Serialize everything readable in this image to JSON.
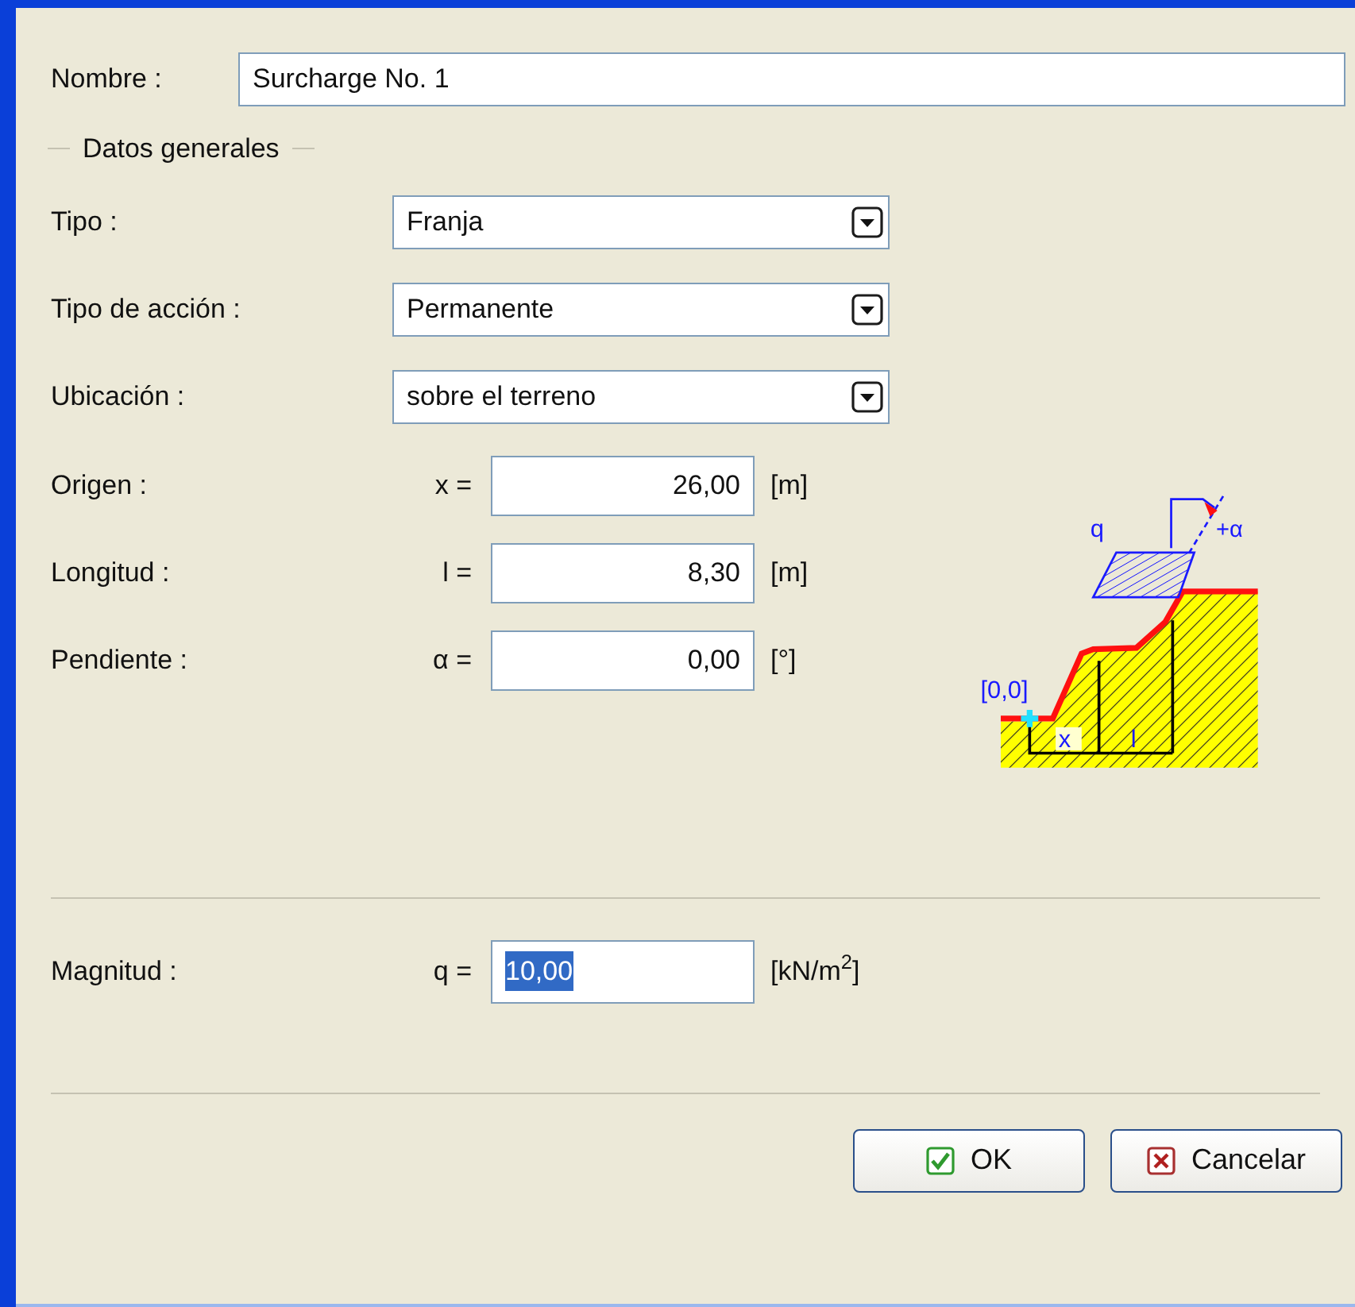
{
  "name_field": {
    "label": "Nombre :",
    "value": "Surcharge No. 1"
  },
  "section": {
    "title": "Datos generales"
  },
  "selects": [
    {
      "label": "Tipo :",
      "value": "Franja"
    },
    {
      "label": "Tipo de acción :",
      "value": "Permanente"
    },
    {
      "label": "Ubicación :",
      "value": "sobre el terreno"
    }
  ],
  "numeric_fields": [
    {
      "label": "Origen :",
      "symbol": "x =",
      "value": "26,00",
      "unit": "[m]"
    },
    {
      "label": "Longitud :",
      "symbol": "l =",
      "value": "8,30",
      "unit": "[m]"
    },
    {
      "label": "Pendiente :",
      "symbol": "α =",
      "value": "0,00",
      "unit": "[°]"
    }
  ],
  "diagram": {
    "labels": [
      "q",
      "+α",
      "[0,0]",
      "x",
      "l"
    ]
  },
  "magnitude": {
    "label": "Magnitud :",
    "symbol": "q =",
    "value": "10,00",
    "selected": true,
    "unit": "[kN/m$^{2}$]"
  },
  "buttons": [
    {
      "kind": "ok",
      "label": "OK"
    },
    {
      "kind": "cancel",
      "label": "Cancelar"
    }
  ]
}
